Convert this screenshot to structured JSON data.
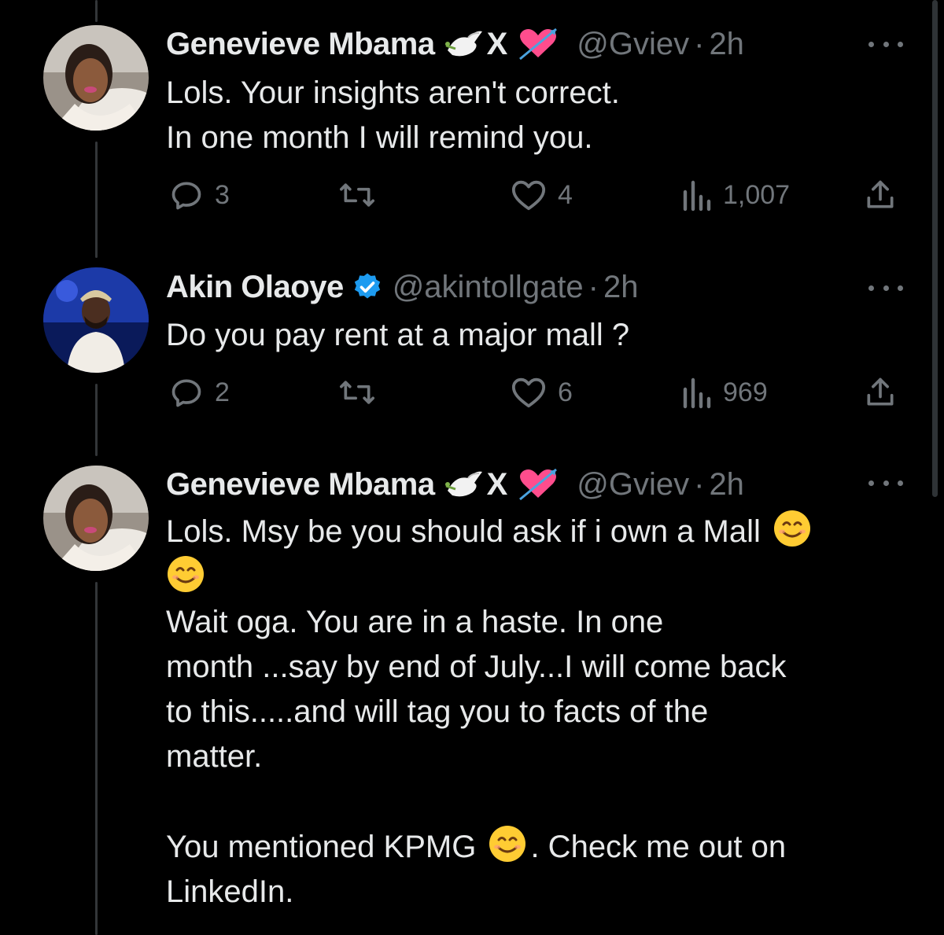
{
  "colors": {
    "background": "#000000",
    "text": "#e7e9ea",
    "secondary": "#71767b",
    "verified": "#1d9bf0",
    "heart_emoji": "#ff4d8d"
  },
  "tweets": [
    {
      "author": {
        "name": "Genevieve Mbama",
        "name_emojis": [
          "dove-emoji",
          "heart-with-arrow-emoji"
        ],
        "name_letter": "X",
        "handle": "@Gviev",
        "time": "2h",
        "verified": false
      },
      "lines": [
        "Lols. Your insights aren't correct.",
        "In one month I will remind you."
      ],
      "stats": {
        "replies": "3",
        "likes": "4",
        "views": "1,007"
      }
    },
    {
      "author": {
        "name": "Akin Olaoye",
        "handle": "@akintollgate",
        "time": "2h",
        "verified": true
      },
      "lines": [
        "Do you pay rent at a major mall ?"
      ],
      "stats": {
        "replies": "2",
        "likes": "6",
        "views": "969"
      }
    },
    {
      "author": {
        "name": "Genevieve Mbama",
        "name_emojis": [
          "dove-emoji",
          "heart-with-arrow-emoji"
        ],
        "name_letter": "X",
        "handle": "@Gviev",
        "time": "2h",
        "verified": false
      },
      "text_parts": {
        "p1": "Lols. Msy be you should ask if i own a Mall",
        "p2_l1": "Wait oga. You are in a haste. In one",
        "p2_l2": "month ...say by end of July...I will come back",
        "p2_l3": "to this.....and will tag you to facts of the",
        "p2_l4": "matter.",
        "p3_a": "You mentioned KPMG",
        "p3_b": ". Check me out on",
        "p3_c": "LinkedIn."
      }
    }
  ],
  "separator": "·"
}
